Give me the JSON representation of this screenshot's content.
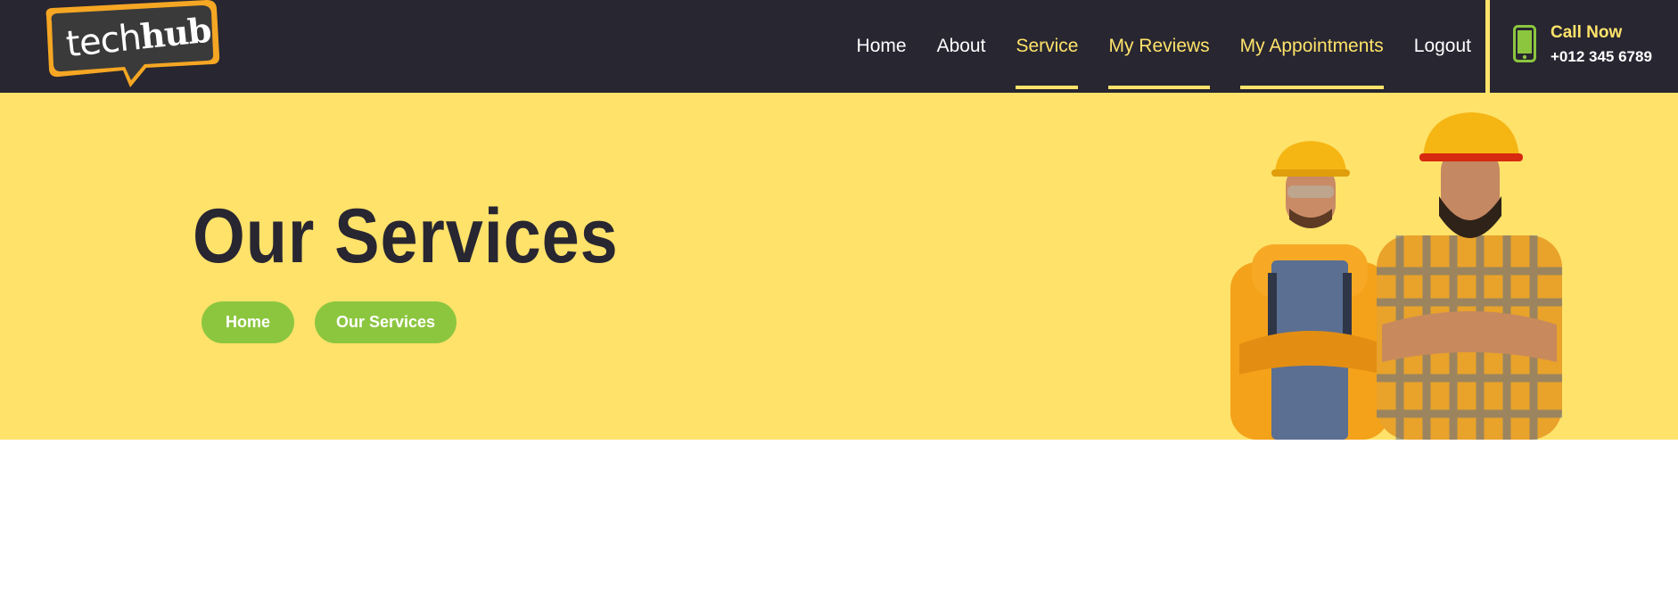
{
  "header": {
    "logo": {
      "part1": "tech",
      "part2": "hub"
    },
    "nav": [
      {
        "label": "Home",
        "active": false
      },
      {
        "label": "About",
        "active": false
      },
      {
        "label": "Service",
        "active": true
      },
      {
        "label": "My Reviews",
        "active": true
      },
      {
        "label": "My Appointments",
        "active": true
      },
      {
        "label": "Logout",
        "active": false
      }
    ],
    "call": {
      "icon": "phone-icon",
      "title": "Call Now",
      "number": "+012 345 6789"
    }
  },
  "hero": {
    "title": "Our Services",
    "breadcrumb": [
      {
        "label": "Home"
      },
      {
        "label": "Our Services"
      }
    ],
    "image": "two-workers-in-hard-hats"
  },
  "colors": {
    "dark": "#272631",
    "accent_yellow": "#ffe26a",
    "accent_green": "#8cc63f",
    "logo_orange": "#f5a623"
  }
}
